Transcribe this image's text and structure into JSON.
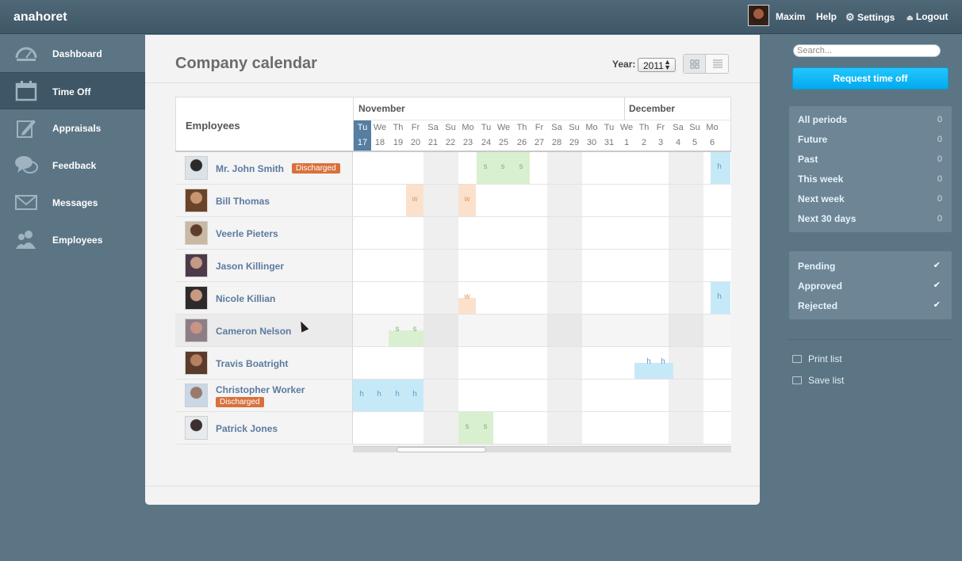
{
  "app": {
    "name": "anahoret"
  },
  "topbar": {
    "user_name": "Maxim",
    "help": "Help",
    "settings": "Settings",
    "logout": "Logout"
  },
  "sidebar": {
    "items": [
      {
        "label": "Dashboard",
        "icon": "gauge-icon"
      },
      {
        "label": "Time Off",
        "icon": "calendar-icon",
        "active": true
      },
      {
        "label": "Appraisals",
        "icon": "pencil-icon"
      },
      {
        "label": "Feedback",
        "icon": "chat-bubbles-icon"
      },
      {
        "label": "Messages",
        "icon": "envelope-icon"
      },
      {
        "label": "Employees",
        "icon": "people-icon"
      }
    ]
  },
  "page": {
    "title": "Company calendar",
    "year_label": "Year:",
    "year_value": "2011"
  },
  "calendar": {
    "employees_header": "Employees",
    "months": [
      "November",
      "December"
    ],
    "days": [
      {
        "dow": "Tu",
        "num": "17",
        "today": true
      },
      {
        "dow": "We",
        "num": "18"
      },
      {
        "dow": "Th",
        "num": "19"
      },
      {
        "dow": "Fr",
        "num": "20"
      },
      {
        "dow": "Sa",
        "num": "21",
        "weekend": true
      },
      {
        "dow": "Su",
        "num": "22",
        "weekend": true
      },
      {
        "dow": "Mo",
        "num": "23"
      },
      {
        "dow": "Tu",
        "num": "24"
      },
      {
        "dow": "We",
        "num": "25"
      },
      {
        "dow": "Th",
        "num": "26"
      },
      {
        "dow": "Fr",
        "num": "27"
      },
      {
        "dow": "Sa",
        "num": "28",
        "weekend": true
      },
      {
        "dow": "Su",
        "num": "29",
        "weekend": true
      },
      {
        "dow": "Mo",
        "num": "30"
      },
      {
        "dow": "Tu",
        "num": "31"
      },
      {
        "dow": "We",
        "num": "1"
      },
      {
        "dow": "Th",
        "num": "2"
      },
      {
        "dow": "Fr",
        "num": "3"
      },
      {
        "dow": "Sa",
        "num": "4",
        "weekend": true
      },
      {
        "dow": "Su",
        "num": "5",
        "weekend": true
      },
      {
        "dow": "Mo",
        "num": "6"
      }
    ],
    "employees": [
      {
        "name": "Mr. John Smith",
        "badge": "Discharged",
        "photo_colors": [
          "#dbe3e8",
          "#2c2a28"
        ]
      },
      {
        "name": "Bill Thomas",
        "photo_colors": [
          "#6b4328",
          "#c79672"
        ]
      },
      {
        "name": "Veerle Pieters",
        "photo_colors": [
          "#c9b9a2",
          "#5d3d2c"
        ]
      },
      {
        "name": "Jason Killinger",
        "photo_colors": [
          "#4c3a4a",
          "#c29a86"
        ]
      },
      {
        "name": "Nicole Killian",
        "photo_colors": [
          "#2e2a2a",
          "#c89a82"
        ]
      },
      {
        "name": "Cameron Nelson",
        "photo_colors": [
          "#8e7d86",
          "#c89486"
        ]
      },
      {
        "name": "Travis Boatright",
        "photo_colors": [
          "#5b3b2a",
          "#b57f62"
        ]
      },
      {
        "name": "Christopher Worker",
        "badge": "Discharged",
        "photo_colors": [
          "#c9d7e6",
          "#9a7a6a"
        ]
      },
      {
        "name": "Patrick Jones",
        "photo_colors": [
          "#e8ebee",
          "#3a3030"
        ]
      }
    ],
    "legend": {
      "s": "s",
      "w": "w",
      "h": "h"
    }
  },
  "right": {
    "search_placeholder": "Search...",
    "request_button": "Request time off",
    "periods": [
      {
        "label": "All periods",
        "count": "0"
      },
      {
        "label": "Future",
        "count": "0"
      },
      {
        "label": "Past",
        "count": "0"
      },
      {
        "label": "This week",
        "count": "0"
      },
      {
        "label": "Next week",
        "count": "0"
      },
      {
        "label": "Next 30 days",
        "count": "0"
      }
    ],
    "statuses": [
      {
        "label": "Pending",
        "checked": true
      },
      {
        "label": "Approved",
        "checked": true
      },
      {
        "label": "Rejected",
        "checked": true
      }
    ],
    "actions": [
      {
        "label": "Print list",
        "icon": "printer-icon"
      },
      {
        "label": "Save list",
        "icon": "save-icon"
      }
    ]
  },
  "colors": {
    "accent": "#03a9ee",
    "today": "#557ea2",
    "discharged": "#d9703b",
    "sick": "#d9f0d0",
    "work": "#fbe1cc",
    "holiday": "#c6e9f8"
  }
}
